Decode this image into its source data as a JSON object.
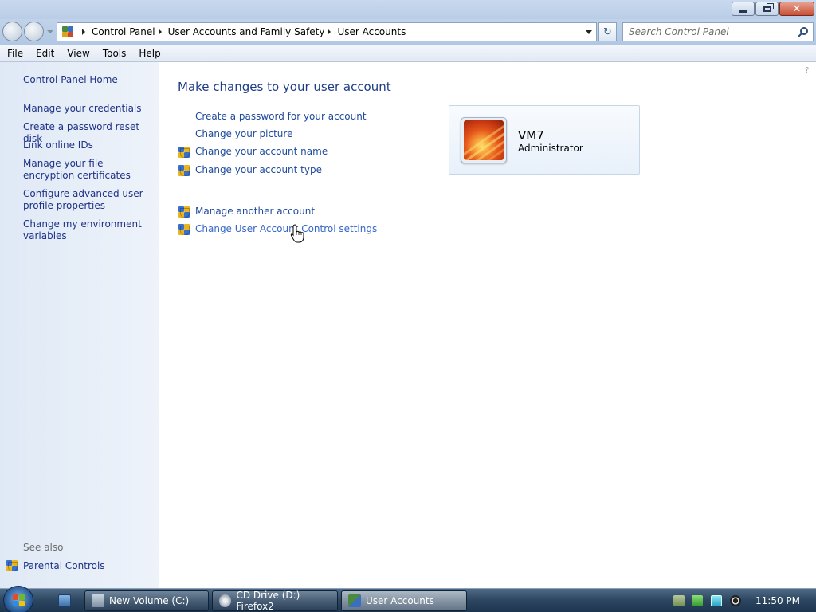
{
  "window": {
    "caption_buttons": {
      "minimize_icon": "minimize-icon",
      "restore_icon": "restore-icon",
      "close_icon": "close-icon",
      "close_glyph": "✕"
    }
  },
  "address_bar": {
    "breadcrumbs": [
      "Control Panel",
      "User Accounts and Family Safety",
      "User Accounts"
    ],
    "refresh_glyph": "↻",
    "search_placeholder": "Search Control Panel"
  },
  "menu": [
    "File",
    "Edit",
    "View",
    "Tools",
    "Help"
  ],
  "sidebar": {
    "home": "Control Panel Home",
    "items": [
      "Manage your credentials",
      "Create a password reset disk",
      "Link online IDs",
      "Manage your file encryption certificates",
      "Configure advanced user profile properties",
      "Change my environment variables"
    ],
    "see_also_title": "See also",
    "see_also_items": [
      "Parental Controls"
    ]
  },
  "main": {
    "title": "Make changes to your user account",
    "tasks": [
      "Create a password for your account",
      "Change your picture",
      "Change your account name",
      "Change your account type"
    ],
    "other_tasks": [
      "Manage another account",
      "Change User Account Control settings"
    ]
  },
  "account": {
    "name": "VM7",
    "role": "Administrator"
  },
  "taskbar": {
    "buttons": [
      "New Volume (C:)",
      "CD Drive (D:) Firefox2",
      "User Accounts"
    ],
    "active_button": "User Accounts",
    "clock": "11:50 PM"
  },
  "colors": {
    "link": "#1e4a9c",
    "sidebar_bg": "#dfe9f5",
    "taskbar": "#2c4660"
  }
}
